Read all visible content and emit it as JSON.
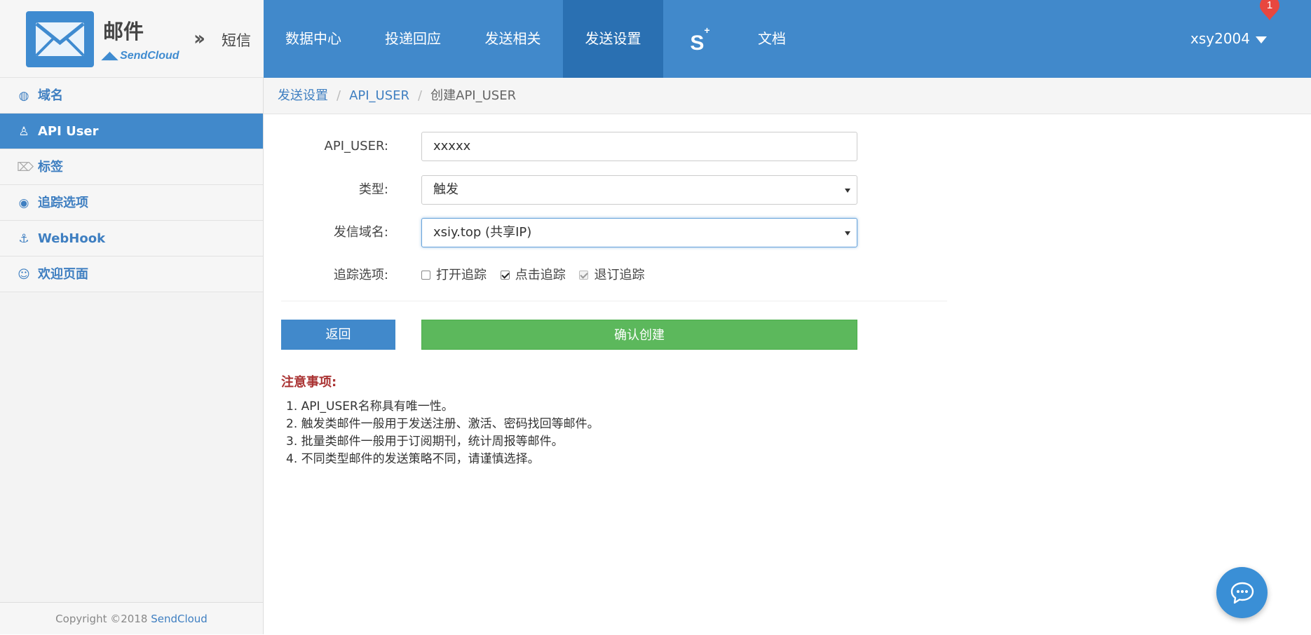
{
  "header": {
    "product_title": "邮件",
    "brand": "SendCloud",
    "switch_label": "短信",
    "nav": [
      {
        "label": "数据中心"
      },
      {
        "label": "投递回应"
      },
      {
        "label": "发送相关"
      },
      {
        "label": "发送设置",
        "active": true
      },
      {
        "label": "S+"
      },
      {
        "label": "文档"
      }
    ],
    "username": "xsy2004",
    "notification_count": "1"
  },
  "sidebar": {
    "items": [
      {
        "label": "域名",
        "icon": "globe-icon"
      },
      {
        "label": "API User",
        "icon": "user-icon",
        "active": true
      },
      {
        "label": "标签",
        "icon": "tag-icon"
      },
      {
        "label": "追踪选项",
        "icon": "eye-icon"
      },
      {
        "label": "WebHook",
        "icon": "anchor-icon"
      },
      {
        "label": "欢迎页面",
        "icon": "smile-icon"
      }
    ],
    "copyright_prefix": "Copyright ©2018",
    "copyright_link": "SendCloud"
  },
  "breadcrumb": [
    "发送设置",
    "API_USER",
    "创建API_USER"
  ],
  "form": {
    "api_user_label": "API_USER:",
    "api_user_value": "xxxxx",
    "type_label": "类型:",
    "type_value": "触发",
    "domain_label": "发信域名:",
    "domain_value": "xsiy.top (共享IP)",
    "tracking_label": "追踪选项:",
    "tracking_options": [
      {
        "label": "打开追踪",
        "checked": false,
        "disabled": false
      },
      {
        "label": "点击追踪",
        "checked": true,
        "disabled": false
      },
      {
        "label": "退订追踪",
        "checked": true,
        "disabled": true
      }
    ]
  },
  "buttons": {
    "back": "返回",
    "confirm": "确认创建"
  },
  "notice": {
    "title": "注意事项:",
    "items": [
      "1. API_USER名称具有唯一性。",
      "2. 触发类邮件一般用于发送注册、激活、密码找回等邮件。",
      "3. 批量类邮件一般用于订阅期刊，统计周报等邮件。",
      "4. 不同类型邮件的发送策略不同，请谨慎选择。"
    ]
  },
  "colors": {
    "primary": "#4189cb",
    "nav_active": "#2a70b2",
    "confirm_green": "#5cb85c",
    "notice_red": "#a33333",
    "badge_red": "#e8473f"
  }
}
